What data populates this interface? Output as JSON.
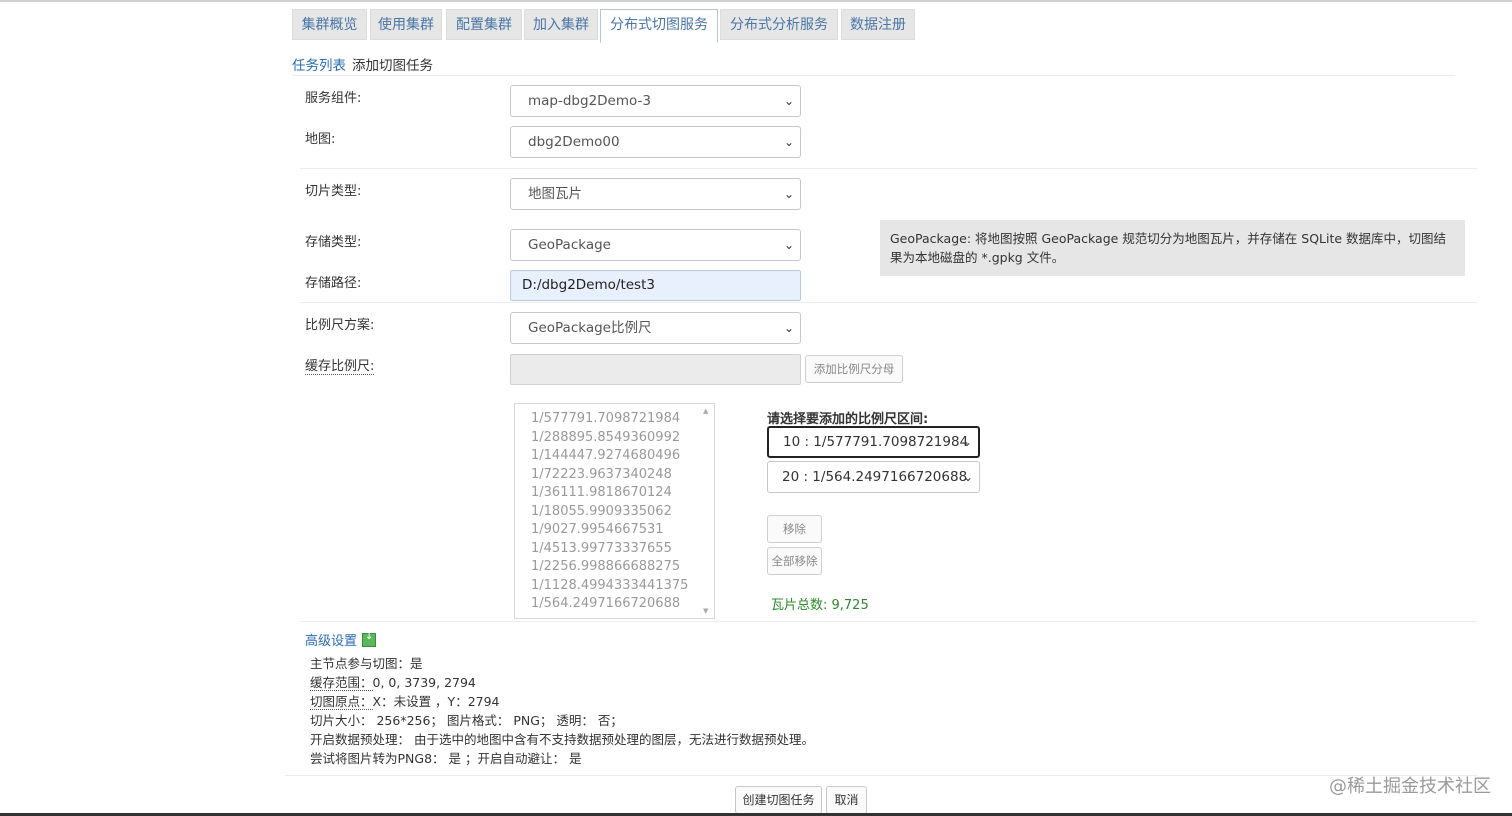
{
  "tabs": [
    {
      "label": "集群概览",
      "active": false
    },
    {
      "label": "使用集群",
      "active": false
    },
    {
      "label": "配置集群",
      "active": false
    },
    {
      "label": "加入集群",
      "active": false
    },
    {
      "label": "分布式切图服务",
      "active": true
    },
    {
      "label": "分布式分析服务",
      "active": false
    },
    {
      "label": "数据注册",
      "active": false
    }
  ],
  "breadcrumb": {
    "link": "任务列表",
    "current": "添加切图任务"
  },
  "form": {
    "service_component": {
      "label": "服务组件:",
      "value": "map-dbg2Demo-3"
    },
    "map": {
      "label": "地图:",
      "value": "dbg2Demo00"
    },
    "tile_type": {
      "label": "切片类型:",
      "value": "地图瓦片"
    },
    "storage_type": {
      "label": "存储类型:",
      "value": "GeoPackage"
    },
    "storage_path": {
      "label": "存储路径:",
      "value": "D:/dbg2Demo/test3"
    },
    "scale_scheme": {
      "label": "比例尺方案:",
      "value": "GeoPackage比例尺"
    },
    "cache_scale": {
      "label": "缓存比例尺:",
      "add_button": "添加比例尺分母"
    }
  },
  "info": "GeoPackage: 将地图按照 GeoPackage 规范切分为地图瓦片，并存储在 SQLite 数据库中，切图结果为本地磁盘的 *.gpkg 文件。",
  "scale_list": [
    "1/577791.7098721984",
    "1/288895.8549360992",
    "1/144447.9274680496",
    "1/72223.9637340248",
    "1/36111.9818670124",
    "1/18055.9909335062",
    "1/9027.9954667531",
    "1/4513.99773337655",
    "1/2256.998866688275",
    "1/1128.4994333441375",
    "1/564.2497166720688"
  ],
  "range": {
    "title": "请选择要添加的比例尺区间:",
    "from": "10 : 1/577791.7098721984",
    "to": "20 : 1/564.2497166720688",
    "remove": "移除",
    "remove_all": "全部移除",
    "tile_total": "瓦片总数: 9,725"
  },
  "advanced": {
    "label": "高级设置",
    "lines": {
      "l1": "主节点参与切图：是",
      "l2_label": "缓存范围：",
      "l2_value": "0, 0, 3739, 2794",
      "l3_label": "切图原点：",
      "l3_value": "X：未设置 ，Y：2794",
      "l4": "切片大小： 256*256； 图片格式： PNG； 透明： 否；",
      "l5": "开启数据预处理： 由于选中的地图中含有不支持数据预处理的图层，无法进行数据预处理。",
      "l6": "尝试将图片转为PNG8： 是 ；开启自动避让： 是"
    }
  },
  "actions": {
    "create": "创建切图任务",
    "cancel": "取消"
  },
  "watermark": "@稀土掘金技术社区"
}
